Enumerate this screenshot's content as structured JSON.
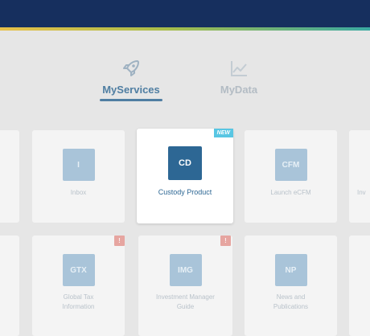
{
  "nav": {
    "tabs": [
      {
        "label": "MyServices",
        "icon": "rocket-icon",
        "active": true
      },
      {
        "label": "MyData",
        "icon": "line-chart-icon",
        "active": false
      }
    ]
  },
  "tiles_row1": [
    {
      "abbr": "I",
      "label": "Inbox"
    },
    {
      "abbr": "CD",
      "label": "Custody Product",
      "badge": "NEW"
    },
    {
      "abbr": "CFM",
      "label": "Launch eCFM"
    },
    {
      "abbr": "",
      "label": "Inv"
    }
  ],
  "tiles_row2": [
    {
      "abbr": "GTX",
      "label_line1": "Global Tax",
      "label_line2": "Information",
      "badge": "!"
    },
    {
      "abbr": "IMG",
      "label_line1": "Investment Manager",
      "label_line2": "Guide",
      "badge": "!"
    },
    {
      "abbr": "NP",
      "label_line1": "News and",
      "label_line2": "Publications"
    }
  ],
  "colors": {
    "header": "#162f5e",
    "active_tab": "#4f7ea2",
    "focus_logo": "#2d6794",
    "new_badge": "#58c6e3"
  }
}
